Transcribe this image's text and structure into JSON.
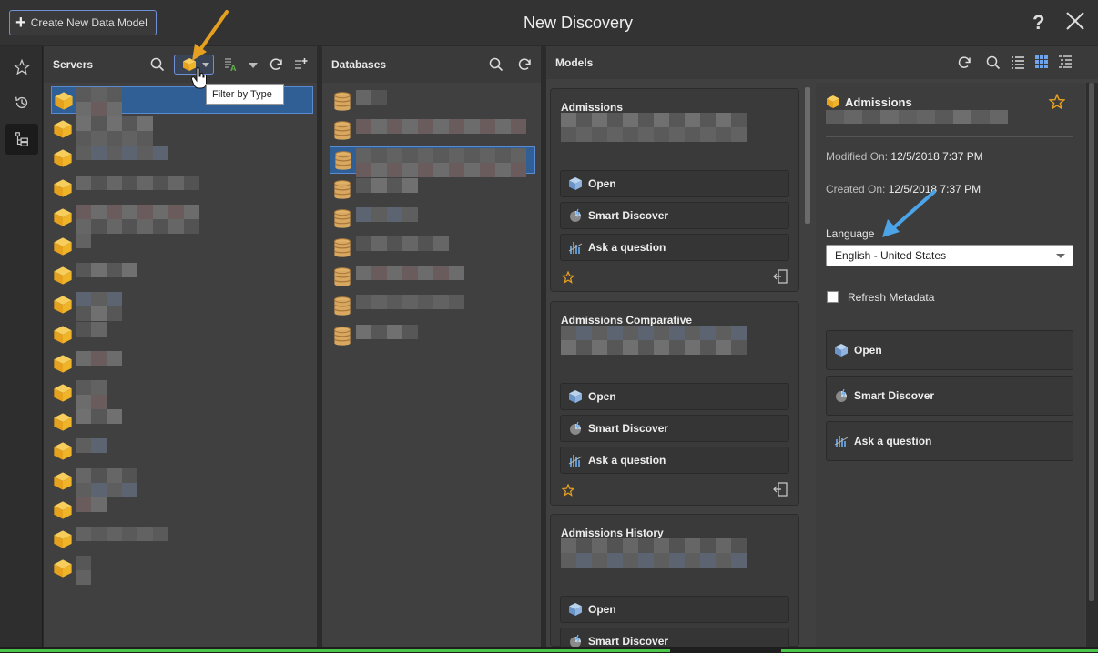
{
  "window": {
    "title": "New Discovery",
    "create_button": "Create New Data Model"
  },
  "servers": {
    "title": "Servers",
    "tooltip": "Filter by Type",
    "row_count": 17
  },
  "databases": {
    "title": "Databases",
    "row_count": 9
  },
  "models": {
    "title": "Models",
    "cards": [
      {
        "name": "Admissions",
        "actions": [
          "Open",
          "Smart Discover",
          "Ask a question"
        ]
      },
      {
        "name": "Admissions Comparative",
        "actions": [
          "Open",
          "Smart Discover",
          "Ask a question"
        ]
      },
      {
        "name": "Admissions History",
        "actions": [
          "Open",
          "Smart Discover"
        ]
      }
    ]
  },
  "details": {
    "name": "Admissions",
    "modified_label": "Modified On:",
    "modified_value": "12/5/2018 7:37 PM",
    "created_label": "Created On:",
    "created_value": "12/5/2018 7:37 PM",
    "language_label": "Language",
    "language_value": "English - United States",
    "refresh_label": "Refresh Metadata",
    "actions": [
      "Open",
      "Smart Discover",
      "Ask a question"
    ]
  },
  "colors": {
    "accent_blue": "#6f8fd6",
    "selection": "#2f5f95",
    "cube_gold": "#f0b429",
    "db_tan": "#d8a860",
    "arrow_orange": "#e5a021",
    "arrow_blue": "#4ba3e8",
    "status_green": "#4cc64a"
  }
}
